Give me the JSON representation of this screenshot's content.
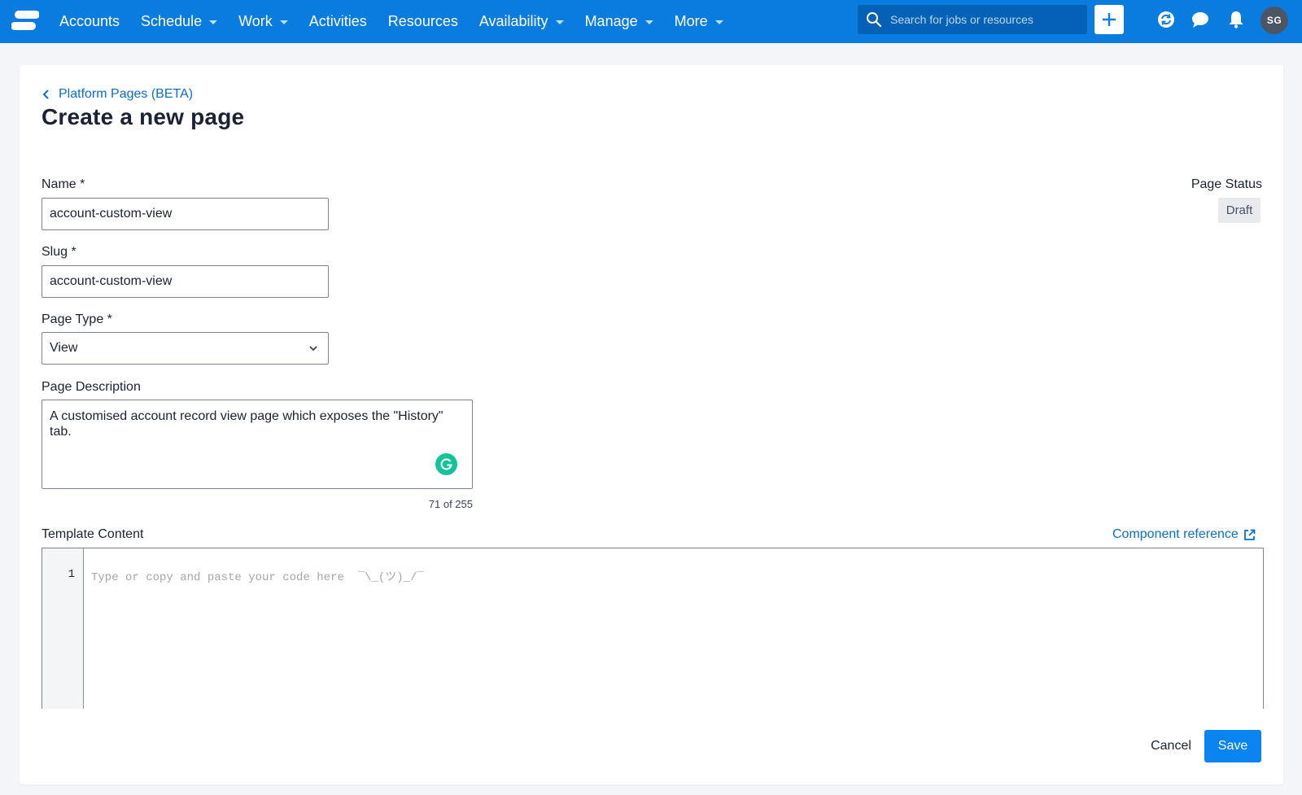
{
  "nav": {
    "items": [
      {
        "label": "Accounts",
        "dropdown": false
      },
      {
        "label": "Schedule",
        "dropdown": true
      },
      {
        "label": "Work",
        "dropdown": true
      },
      {
        "label": "Activities",
        "dropdown": false
      },
      {
        "label": "Resources",
        "dropdown": false
      },
      {
        "label": "Availability",
        "dropdown": true
      },
      {
        "label": "Manage",
        "dropdown": true
      },
      {
        "label": "More",
        "dropdown": true
      }
    ],
    "search_placeholder": "Search for jobs or resources",
    "avatar_initials": "SG"
  },
  "page": {
    "breadcrumb": "Platform Pages (BETA)",
    "title": "Create a new page"
  },
  "form": {
    "name_label": "Name *",
    "name_value": "account-custom-view",
    "slug_label": "Slug *",
    "slug_value": "account-custom-view",
    "page_type_label": "Page Type *",
    "page_type_value": "View",
    "description_label": "Page Description",
    "description_value": "A customised account record view page which exposes the \"History\" tab.",
    "description_counter": "71 of 255",
    "template_label": "Template Content",
    "component_reference": "Component reference",
    "line_number": "1",
    "code_placeholder": "Type or copy and paste your code here  ¯\\_(ツ)_/¯"
  },
  "status": {
    "label": "Page Status",
    "value": "Draft"
  },
  "actions": {
    "cancel": "Cancel",
    "save": "Save"
  },
  "colors": {
    "topbar": "#0a7ce0",
    "primary_button": "#0a84f0",
    "link": "#0a6fc9",
    "grammarly": "#15c39a"
  },
  "icons": [
    "logo-icon",
    "search-icon",
    "plus-icon",
    "sync-icon",
    "chat-icon",
    "bell-icon",
    "chevron-left-icon",
    "chevron-down-icon",
    "grammarly-icon",
    "external-link-icon"
  ]
}
